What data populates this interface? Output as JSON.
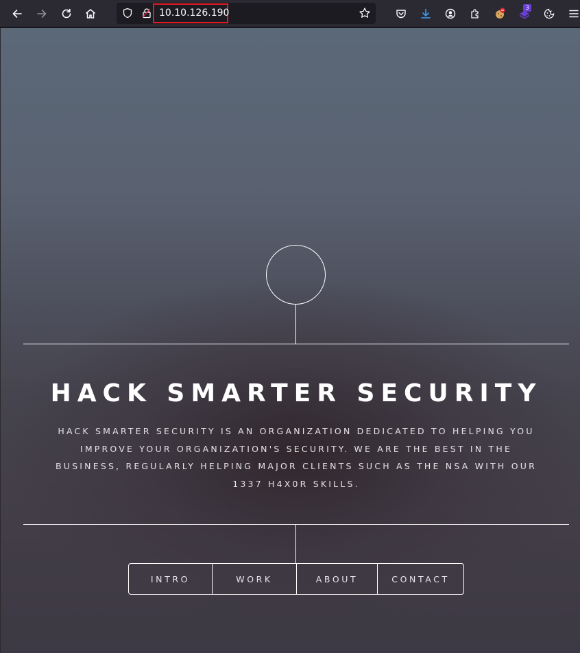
{
  "browser": {
    "url": "10.10.126.190",
    "extension_badge_count": "3",
    "colors": {
      "toolbar": "#2b2a33",
      "urlbar": "#1c1b22",
      "highlight": "#e01b24"
    },
    "icons": [
      "back-icon",
      "forward-icon",
      "reload-icon",
      "home-icon",
      "shield-icon",
      "lock-icon",
      "bookmark-star-icon",
      "pocket-icon",
      "download-icon",
      "account-icon",
      "extensions-icon",
      "cookie-extension-icon",
      "purple-extension-icon",
      "cookie-icon",
      "menu-icon"
    ]
  },
  "hero": {
    "title": "HACK SMARTER SECURITY",
    "description_lines": [
      "HACK SMARTER SECURITY IS AN ORGANIZATION DEDICATED TO HELPING YOU",
      "IMPROVE YOUR ORGANIZATION'S SECURITY. WE ARE THE BEST IN THE",
      "BUSINESS, REGULARLY HELPING MAJOR CLIENTS SUCH AS THE NSA WITH OUR",
      "1337 H4X0R SKILLS."
    ]
  },
  "nav": {
    "items": [
      {
        "label": "INTRO"
      },
      {
        "label": "WORK"
      },
      {
        "label": "ABOUT"
      },
      {
        "label": "CONTACT"
      }
    ]
  }
}
